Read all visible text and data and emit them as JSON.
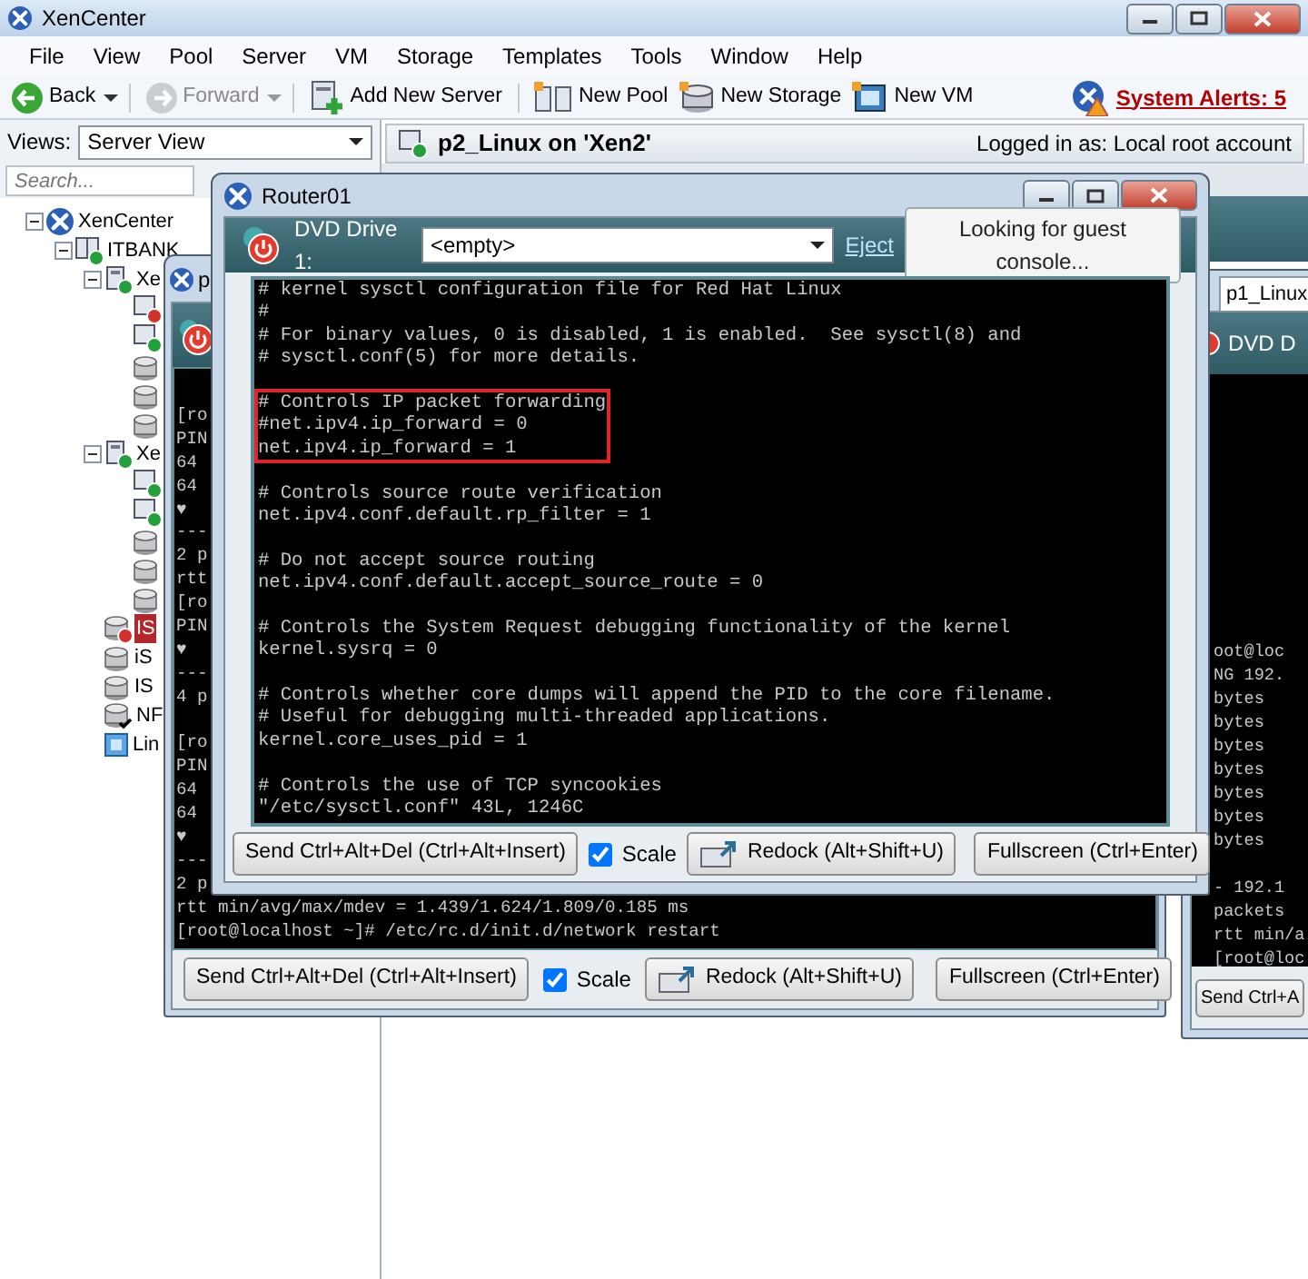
{
  "window": {
    "title": "XenCenter"
  },
  "menu": [
    "File",
    "View",
    "Pool",
    "Server",
    "VM",
    "Storage",
    "Templates",
    "Tools",
    "Window",
    "Help"
  ],
  "toolbar": [
    {
      "kind": "back",
      "label": "Back",
      "disabled": false,
      "dropdown": true
    },
    {
      "kind": "forward",
      "label": "Forward",
      "disabled": true,
      "dropdown": true
    },
    {
      "kind": "add_server",
      "label": "Add New Server",
      "disabled": false,
      "dropdown": false
    },
    {
      "kind": "new_pool",
      "label": "New Pool",
      "disabled": false,
      "dropdown": false
    },
    {
      "kind": "new_storage",
      "label": "New Storage",
      "disabled": false,
      "dropdown": false
    },
    {
      "kind": "new_vm",
      "label": "New VM",
      "disabled": false,
      "dropdown": false
    }
  ],
  "system_alerts": "System Alerts: 5",
  "views": {
    "label": "Views:",
    "value": "Server View"
  },
  "search": {
    "placeholder": "Search..."
  },
  "tree": [
    {
      "label": "XenCenter",
      "kind": "root",
      "expanded": true,
      "selected": false,
      "children": [
        {
          "label": "ITBANK",
          "kind": "pool",
          "expanded": true,
          "selected": false,
          "children": [
            {
              "label": "Xe",
              "kind": "host",
              "expanded": true,
              "selected": false,
              "children": [
                {
                  "kind": "vm_stopped",
                  "selected": false
                },
                {
                  "kind": "vm_running",
                  "selected": false
                },
                {
                  "kind": "storage",
                  "selected": false
                },
                {
                  "kind": "storage",
                  "selected": false
                },
                {
                  "kind": "storage",
                  "selected": false
                }
              ]
            },
            {
              "label": "Xe",
              "kind": "host",
              "expanded": true,
              "selected": false,
              "children": [
                {
                  "kind": "vm_running",
                  "selected": false
                },
                {
                  "kind": "vm_running",
                  "selected": false
                },
                {
                  "kind": "storage",
                  "selected": false
                },
                {
                  "kind": "storage",
                  "selected": false
                },
                {
                  "kind": "storage",
                  "selected": false
                }
              ]
            },
            {
              "label": "IS",
              "kind": "storage_error",
              "selected": true
            },
            {
              "label": "iS",
              "kind": "storage",
              "selected": false
            },
            {
              "label": "IS",
              "kind": "storage",
              "selected": false
            },
            {
              "label": "NF",
              "kind": "storage_default",
              "selected": false
            },
            {
              "label": "Lin",
              "kind": "template",
              "selected": false
            }
          ]
        }
      ]
    }
  ],
  "panel": {
    "title": "p2_Linux on 'Xen2'",
    "login": "Logged in as: Local root account"
  },
  "back_console": {
    "title": "p",
    "terminal": [
      {
        "highlighted": false,
        "lines": [
          "[ro",
          "PIN",
          "64",
          "64",
          "♥",
          "---",
          "2 p",
          "rtt",
          "[ro",
          "PIN",
          "♥",
          "---",
          "4 p"
        ]
      },
      {
        "highlighted": false,
        "lines": [
          "[ro",
          "PIN",
          "64",
          "64",
          "♥",
          "---",
          "2 p",
          "rtt min/avg/max/mdev = 1.439/1.624/1.809/0.185 ms",
          "[root@localhost ~]# /etc/rc.d/init.d/network restart"
        ]
      }
    ],
    "footer": [
      {
        "kind": "button",
        "label": "Send Ctrl+Alt+Del (Ctrl+Alt+Insert)"
      },
      {
        "kind": "checkbox",
        "label": "Scale",
        "checked": true
      },
      {
        "kind": "redock",
        "label": "Redock (Alt+Shift+U)"
      },
      {
        "kind": "button",
        "label": "Fullscreen (Ctrl+Enter)"
      }
    ]
  },
  "router_console": {
    "title": "Router01",
    "dvd_label": "DVD Drive 1:",
    "dvd_value": "<empty>",
    "eject": "Eject",
    "status": "Looking for guest console...",
    "terminal": [
      {
        "highlighted": false,
        "lines": [
          "# kernel sysctl configuration file for Red Hat Linux",
          "#",
          "# For binary values, 0 is disabled, 1 is enabled.  See sysctl(8) and",
          "# sysctl.conf(5) for more details."
        ]
      },
      {
        "highlighted": true,
        "lines": [
          "# Controls IP packet forwarding",
          "#net.ipv4.ip_forward = 0",
          "net.ipv4.ip_forward = 1"
        ]
      },
      {
        "highlighted": false,
        "lines": [
          "# Controls source route verification",
          "net.ipv4.conf.default.rp_filter = 1"
        ]
      },
      {
        "highlighted": false,
        "lines": [
          "# Do not accept source routing",
          "net.ipv4.conf.default.accept_source_route = 0"
        ]
      },
      {
        "highlighted": false,
        "lines": [
          "# Controls the System Request debugging functionality of the kernel",
          "kernel.sysrq = 0"
        ]
      },
      {
        "highlighted": false,
        "lines": [
          "# Controls whether core dumps will append the PID to the core filename.",
          "# Useful for debugging multi-threaded applications.",
          "kernel.core_uses_pid = 1"
        ]
      },
      {
        "highlighted": false,
        "lines": [
          "# Controls the use of TCP syncookies",
          "\"/etc/sysctl.conf\" 43L, 1246C"
        ]
      }
    ],
    "footer": [
      {
        "kind": "button",
        "label": "Send Ctrl+Alt+Del (Ctrl+Alt+Insert)"
      },
      {
        "kind": "checkbox",
        "label": "Scale",
        "checked": true
      },
      {
        "kind": "redock",
        "label": "Redock (Alt+Shift+U)"
      },
      {
        "kind": "button",
        "label": "Fullscreen (Ctrl+Enter)"
      }
    ]
  },
  "side_console": {
    "tab": "p1_Linux",
    "dvd_label": "DVD D",
    "terminal": [
      {
        "highlighted": false,
        "lines": [
          "oot@loc",
          "NG 192.",
          "bytes",
          "bytes",
          "bytes",
          "bytes",
          "bytes",
          "bytes",
          "bytes"
        ]
      },
      {
        "highlighted": false,
        "lines": [
          "- 192.1",
          "packets",
          "rtt min/a",
          "[root@loc"
        ]
      }
    ],
    "footer": [
      {
        "kind": "button",
        "label": "Send Ctrl+A"
      }
    ]
  }
}
